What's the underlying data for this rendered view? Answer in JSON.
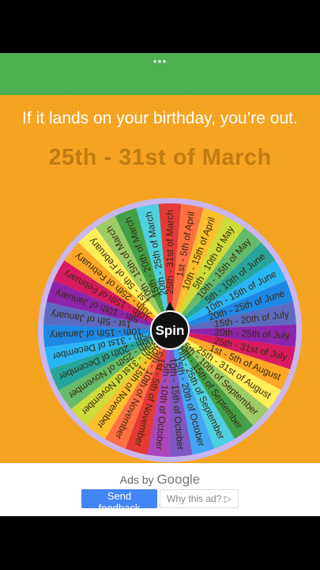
{
  "menu_dots": "•••",
  "prompt": "If it lands on your birthday, you’re out.",
  "result": "25th - 31st of March",
  "wheel": {
    "spin_label": "Spin",
    "segments": [
      "25th - 31st of March",
      "1st - 5th of April",
      "10th - 15th of April",
      "5th - 10th of May",
      "10th - 15th of May",
      "5th - 10th of June",
      "10th - 15th of June",
      "20th - 25th of June",
      "15th - 20th of July",
      "20th - 25th of July",
      "25th - 31st of July",
      "1st - 5th of August",
      "25th - 31st of August",
      "5th - 10th of September",
      "10th - 15th of September",
      "20th - 25th of September",
      "15th - 20th of October",
      "10th - 15th of October",
      "5th - 10th of October",
      "1st - 5th of November",
      "5th - 10th of November",
      "10th - 15th of November",
      "25th - 31st of November",
      "20th - 25th of November",
      "15th - 20th of December",
      "25th - 31st of December",
      "10th - 15th of January",
      "1st - 5th of January",
      "5th - 10th of January",
      "10th - 15th of February",
      "20th - 25th of February",
      "1st - 5th of February",
      "10th - 15th of March",
      "15th - 20th of March",
      "20th - 25th of March"
    ],
    "colors": [
      "#e53935",
      "#ff7043",
      "#fbc02d",
      "#cddc39",
      "#66bb6a",
      "#26a69a",
      "#29b6f6",
      "#1e88e5",
      "#5c6bc0",
      "#8e24aa",
      "#d81b60",
      "#ffa726",
      "#ffee58",
      "#9ccc65",
      "#43a047",
      "#4dd0e1",
      "#42a5f5",
      "#7e57c2",
      "#ab47bc"
    ]
  },
  "ads": {
    "label": "Ads by",
    "brand": "Google",
    "feedback_button": "Send feedback",
    "why_button": "Why this ad? ▷"
  }
}
